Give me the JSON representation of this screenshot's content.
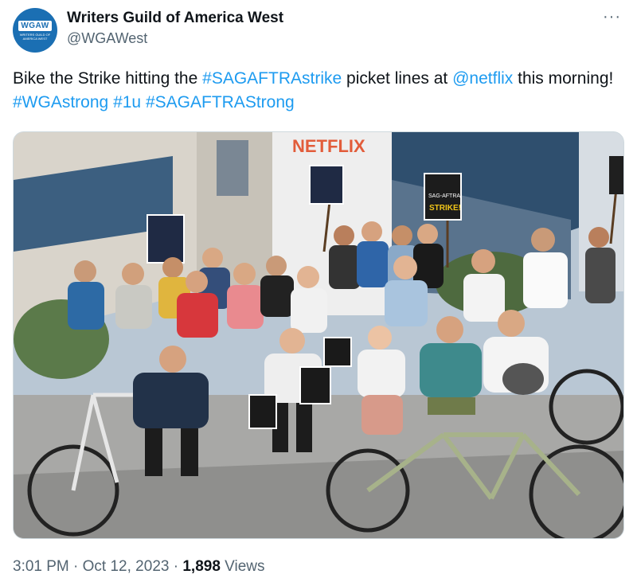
{
  "account": {
    "avatar_badge": "WGAW",
    "avatar_subtext": "WRITERS GUILD OF AMERICA WEST",
    "display_name": "Writers Guild of America West",
    "handle": "@WGAWest"
  },
  "more_glyph": "···",
  "tweet": {
    "text_1": "Bike the Strike hitting the ",
    "hashtag_1": "#SAGAFTRAstrike",
    "text_2": " picket lines at ",
    "mention_1": "@netflix",
    "text_3": " this morning! ",
    "hashtag_2": "#WGAstrong",
    "hashtag_3": "#1u",
    "hashtag_4": "#SAGAFTRAStrong"
  },
  "photo": {
    "building_sign": "NETFLIX",
    "sign_text_1": "SAG-AFTRA",
    "sign_text_2": "STRIKE!"
  },
  "meta": {
    "time": "3:01 PM",
    "separator": "·",
    "date": "Oct 12, 2023",
    "views_count": "1,898",
    "views_label": "Views"
  },
  "colors": {
    "link": "#1d9bf0",
    "secondary_text": "#536471",
    "avatar_bg": "#1b6fb3"
  }
}
